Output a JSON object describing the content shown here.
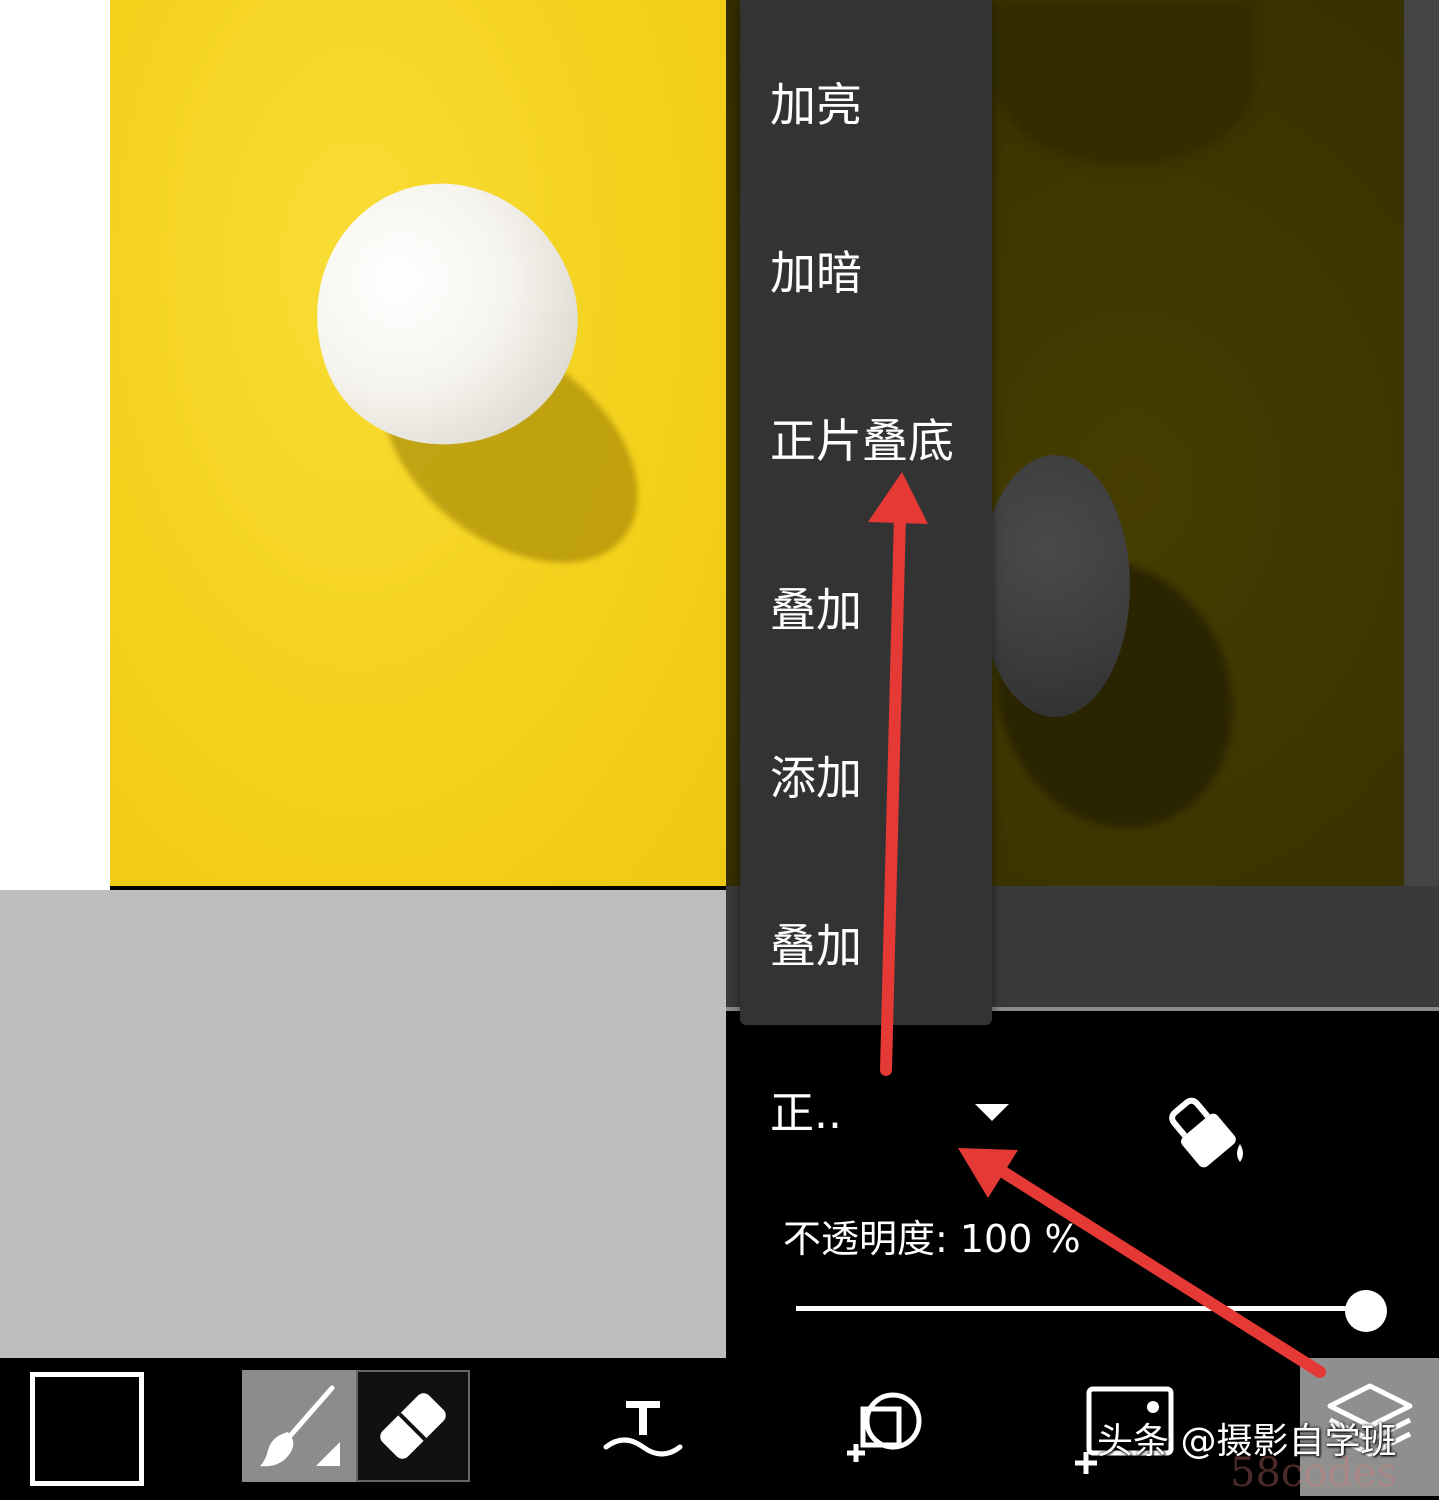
{
  "blend_menu": {
    "items": [
      "加亮",
      "加暗",
      "正片叠底",
      "叠加",
      "添加",
      "叠加"
    ]
  },
  "layer_props": {
    "blend_mode_current": "正..",
    "opacity_label": "不透明度: 100 %",
    "opacity_value": 1.0
  },
  "toolbar": {
    "tools": [
      "color-swatch",
      "brush-icon",
      "eraser-icon",
      "text-icon",
      "add-shape-icon",
      "add-image-icon",
      "layers-icon"
    ]
  },
  "watermark": {
    "text": "头条 @摄影自学班",
    "faint_text": "58codes"
  },
  "colors": {
    "photo_yellow": "#f4d21b",
    "menu_bg": "#333333",
    "arrow_red": "#e53935"
  }
}
